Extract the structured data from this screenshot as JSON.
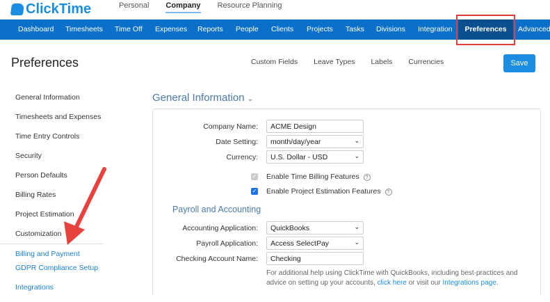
{
  "brand": "ClickTime",
  "top_nav": [
    "Personal",
    "Company",
    "Resource Planning"
  ],
  "nav": [
    "Dashboard",
    "Timesheets",
    "Time Off",
    "Expenses",
    "Reports",
    "People",
    "Clients",
    "Projects",
    "Tasks",
    "Divisions",
    "Integration",
    "Preferences",
    "Advanced"
  ],
  "page_title": "Preferences",
  "sub_tabs": [
    "Custom Fields",
    "Leave Types",
    "Labels",
    "Currencies"
  ],
  "save_label": "Save",
  "sidebar": [
    "General Information",
    "Timesheets and Expenses",
    "Time Entry Controls",
    "Security",
    "Person Defaults",
    "Billing Rates",
    "Project Estimation",
    "Customization",
    "Billing and Payment",
    "GDPR Compliance Setup",
    "Integrations"
  ],
  "section_title": "General Information",
  "form": {
    "company_name_label": "Company Name:",
    "company_name": "ACME Design",
    "date_label": "Date Setting:",
    "date": "month/day/year",
    "currency_label": "Currency:",
    "currency": "U.S. Dollar - USD",
    "time_billing": "Enable Time Billing Features",
    "project_estimation": "Enable Project Estimation Features"
  },
  "payroll": {
    "title": "Payroll and Accounting",
    "accounting_label": "Accounting Application:",
    "accounting": "QuickBooks",
    "payroll_label": "Payroll Application:",
    "payroll": "Access SelectPay",
    "checking_label": "Checking Account Name:",
    "checking": "Checking",
    "note1": "For additional help using ClickTime with QuickBooks, including best-practices and advice on setting up your accounts,",
    "link1": "click here",
    "note2": "or visit our",
    "link2": "Integrations page",
    "note3": "."
  },
  "colors": {
    "nav": "#0a70c9",
    "active_nav": "#0a4f8e",
    "highlight": "#e23c3c"
  }
}
